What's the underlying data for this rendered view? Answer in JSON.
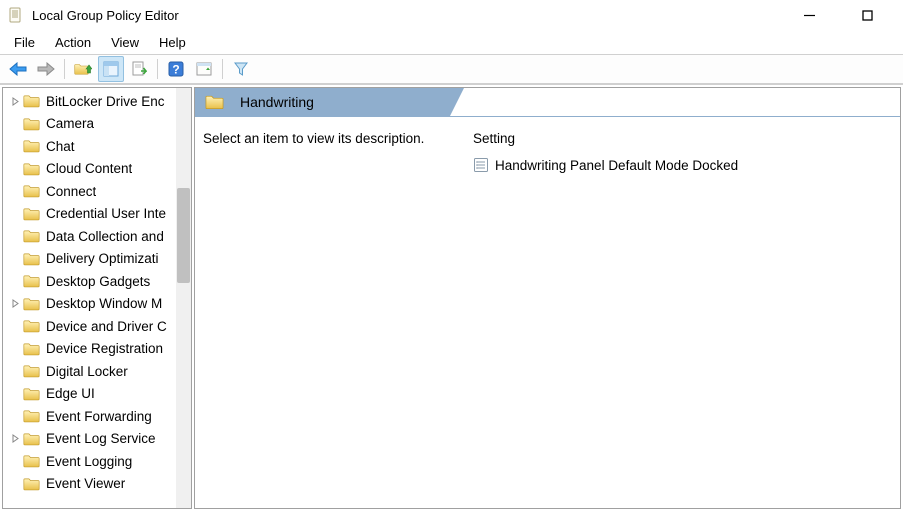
{
  "window": {
    "title": "Local Group Policy Editor"
  },
  "menu": {
    "file": "File",
    "action": "Action",
    "view": "View",
    "help": "Help"
  },
  "tree": {
    "items": [
      {
        "label": "BitLocker Drive Enc",
        "expandable": true
      },
      {
        "label": "Camera",
        "expandable": false
      },
      {
        "label": "Chat",
        "expandable": false
      },
      {
        "label": "Cloud Content",
        "expandable": false
      },
      {
        "label": "Connect",
        "expandable": false
      },
      {
        "label": "Credential User Inte",
        "expandable": false
      },
      {
        "label": "Data Collection and",
        "expandable": false
      },
      {
        "label": "Delivery Optimizati",
        "expandable": false
      },
      {
        "label": "Desktop Gadgets",
        "expandable": false
      },
      {
        "label": "Desktop Window M",
        "expandable": true
      },
      {
        "label": "Device and Driver C",
        "expandable": false
      },
      {
        "label": "Device Registration",
        "expandable": false
      },
      {
        "label": "Digital Locker",
        "expandable": false
      },
      {
        "label": "Edge UI",
        "expandable": false
      },
      {
        "label": "Event Forwarding",
        "expandable": false
      },
      {
        "label": "Event Log Service",
        "expandable": true
      },
      {
        "label": "Event Logging",
        "expandable": false
      },
      {
        "label": "Event Viewer",
        "expandable": false
      }
    ]
  },
  "detail": {
    "header": "Handwriting",
    "description": "Select an item to view its description.",
    "column_header": "Setting",
    "settings": [
      {
        "label": "Handwriting Panel Default Mode Docked"
      }
    ]
  }
}
